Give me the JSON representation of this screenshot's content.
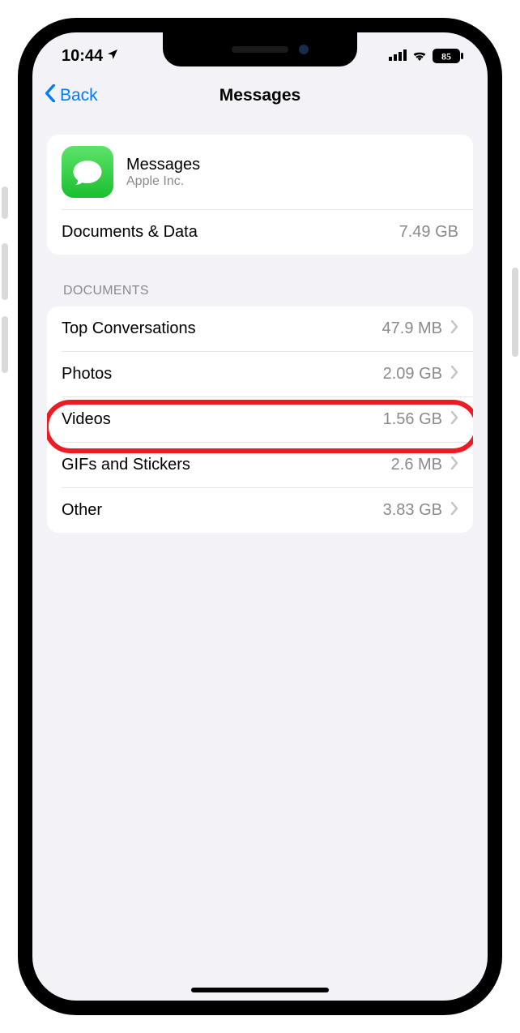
{
  "status": {
    "time": "10:44",
    "battery": "85"
  },
  "nav": {
    "back": "Back",
    "title": "Messages"
  },
  "app": {
    "name": "Messages",
    "vendor": "Apple Inc."
  },
  "docdata": {
    "label": "Documents & Data",
    "value": "7.49 GB"
  },
  "section": "DOCUMENTS",
  "rows": [
    {
      "label": "Top Conversations",
      "value": "47.9 MB"
    },
    {
      "label": "Photos",
      "value": "2.09 GB"
    },
    {
      "label": "Videos",
      "value": "1.56 GB"
    },
    {
      "label": "GIFs and Stickers",
      "value": "2.6 MB"
    },
    {
      "label": "Other",
      "value": "3.83 GB"
    }
  ]
}
